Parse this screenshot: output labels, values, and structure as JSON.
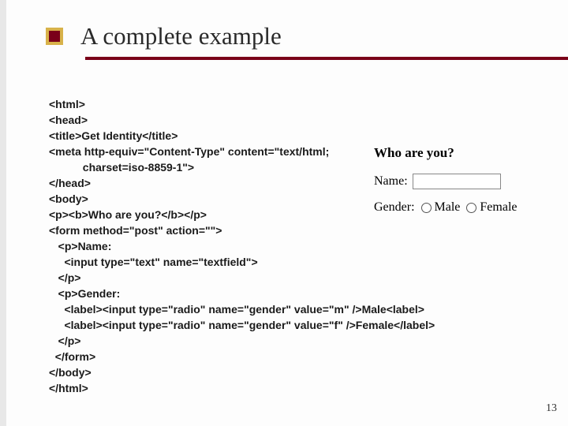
{
  "title": "A complete example",
  "code": {
    "l1": "<html>",
    "l2": "<head>",
    "l3": "<title>Get Identity</title>",
    "l4": "<meta http-equiv=\"Content-Type\" content=\"text/html;",
    "l5": "           charset=iso-8859-1\">",
    "l6": "</head>",
    "l7": "<body>",
    "l8": "<p><b>Who are you?</b></p>",
    "l9": "<form method=\"post\" action=\"\">",
    "l10": "   <p>Name:",
    "l11": "     <input type=\"text\" name=\"textfield\">",
    "l12": "   </p>",
    "l13": "   <p>Gender:",
    "l14": "     <label><input type=\"radio\" name=\"gender\" value=\"m\" />Male<label>",
    "l15": "     <label><input type=\"radio\" name=\"gender\" value=\"f\" />Female</label>",
    "l16": "   </p>",
    "l17": "  </form>",
    "l18": "</body>",
    "l19": "</html>"
  },
  "preview": {
    "heading": "Who are you?",
    "name_label": "Name:",
    "gender_label": "Gender:",
    "male": "Male",
    "female": "Female"
  },
  "slide_number": "13"
}
